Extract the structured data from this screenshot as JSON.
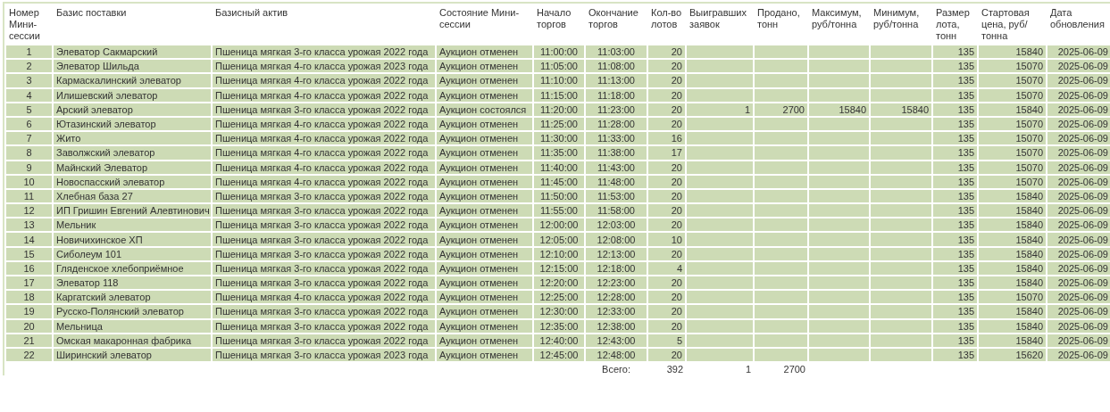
{
  "table": {
    "columns": [
      "Номер Мини-сессии",
      "Базис поставки",
      "Базисный актив",
      "Состояние Мини-сессии",
      "Начало торгов",
      "Окончание торгов",
      "Кол-во лотов",
      "Выигравших заявок",
      "Продано, тонн",
      "Максимум, руб/тонна",
      "Минимум, руб/тонна",
      "Размер лота, тонн",
      "Стартовая цена, руб/тонна",
      "Дата обновления"
    ],
    "rows": [
      {
        "num": "1",
        "basis": "Элеватор Сакмарский",
        "asset": "Пшеница мягкая 3-го класса урожая 2022 года",
        "state": "Аукцион отменен",
        "start": "11:00:00",
        "end": "11:03:00",
        "lots": "20",
        "lot_size": "135",
        "price": "15840",
        "date": "2025-06-09"
      },
      {
        "num": "2",
        "basis": "Элеватор Шильда",
        "asset": "Пшеница мягкая 4-го класса урожая 2023 года",
        "state": "Аукцион отменен",
        "start": "11:05:00",
        "end": "11:08:00",
        "lots": "20",
        "lot_size": "135",
        "price": "15070",
        "date": "2025-06-09"
      },
      {
        "num": "3",
        "basis": "Кармаскалинский элеватор",
        "asset": "Пшеница мягкая 4-го класса урожая 2022 года",
        "state": "Аукцион отменен",
        "start": "11:10:00",
        "end": "11:13:00",
        "lots": "20",
        "lot_size": "135",
        "price": "15070",
        "date": "2025-06-09"
      },
      {
        "num": "4",
        "basis": "Илишевский элеватор",
        "asset": "Пшеница мягкая 4-го класса урожая 2022 года",
        "state": "Аукцион отменен",
        "start": "11:15:00",
        "end": "11:18:00",
        "lots": "20",
        "lot_size": "135",
        "price": "15070",
        "date": "2025-06-09"
      },
      {
        "num": "5",
        "basis": "Арский элеватор",
        "asset": "Пшеница мягкая 3-го класса урожая 2022 года",
        "state": "Аукцион состоялся",
        "start": "11:20:00",
        "end": "11:23:00",
        "lots": "20",
        "won": "1",
        "sold": "2700",
        "max": "15840",
        "min": "15840",
        "lot_size": "135",
        "price": "15840",
        "date": "2025-06-09"
      },
      {
        "num": "6",
        "basis": "Ютазинский элеватор",
        "asset": "Пшеница мягкая 4-го класса урожая 2022 года",
        "state": "Аукцион отменен",
        "start": "11:25:00",
        "end": "11:28:00",
        "lots": "20",
        "lot_size": "135",
        "price": "15070",
        "date": "2025-06-09"
      },
      {
        "num": "7",
        "basis": "Жито",
        "asset": "Пшеница мягкая 4-го класса урожая 2022 года",
        "state": "Аукцион отменен",
        "start": "11:30:00",
        "end": "11:33:00",
        "lots": "16",
        "lot_size": "135",
        "price": "15070",
        "date": "2025-06-09"
      },
      {
        "num": "8",
        "basis": "Заволжский элеватор",
        "asset": "Пшеница мягкая 4-го класса урожая 2022 года",
        "state": "Аукцион отменен",
        "start": "11:35:00",
        "end": "11:38:00",
        "lots": "17",
        "lot_size": "135",
        "price": "15070",
        "date": "2025-06-09"
      },
      {
        "num": "9",
        "basis": "Майнский Элеватор",
        "asset": "Пшеница мягкая 4-го класса урожая 2022 года",
        "state": "Аукцион отменен",
        "start": "11:40:00",
        "end": "11:43:00",
        "lots": "20",
        "lot_size": "135",
        "price": "15070",
        "date": "2025-06-09"
      },
      {
        "num": "10",
        "basis": "Новоспасский элеватор",
        "asset": "Пшеница мягкая 4-го класса урожая 2022 года",
        "state": "Аукцион отменен",
        "start": "11:45:00",
        "end": "11:48:00",
        "lots": "20",
        "lot_size": "135",
        "price": "15070",
        "date": "2025-06-09"
      },
      {
        "num": "11",
        "basis": "Хлебная база 27",
        "asset": "Пшеница мягкая 3-го класса урожая 2022 года",
        "state": "Аукцион отменен",
        "start": "11:50:00",
        "end": "11:53:00",
        "lots": "20",
        "lot_size": "135",
        "price": "15840",
        "date": "2025-06-09"
      },
      {
        "num": "12",
        "basis": "ИП Гришин Евгений Алевтинович",
        "asset": "Пшеница мягкая 3-го класса урожая 2022 года",
        "state": "Аукцион отменен",
        "start": "11:55:00",
        "end": "11:58:00",
        "lots": "20",
        "lot_size": "135",
        "price": "15840",
        "date": "2025-06-09"
      },
      {
        "num": "13",
        "basis": "Мельник",
        "asset": "Пшеница мягкая 3-го класса урожая 2022 года",
        "state": "Аукцион отменен",
        "start": "12:00:00",
        "end": "12:03:00",
        "lots": "20",
        "lot_size": "135",
        "price": "15840",
        "date": "2025-06-09"
      },
      {
        "num": "14",
        "basis": "Новичихинское ХП",
        "asset": "Пшеница мягкая 3-го класса урожая 2022 года",
        "state": "Аукцион отменен",
        "start": "12:05:00",
        "end": "12:08:00",
        "lots": "10",
        "lot_size": "135",
        "price": "15840",
        "date": "2025-06-09"
      },
      {
        "num": "15",
        "basis": "Сиболеум 101",
        "asset": "Пшеница мягкая 3-го класса урожая 2022 года",
        "state": "Аукцион отменен",
        "start": "12:10:00",
        "end": "12:13:00",
        "lots": "20",
        "lot_size": "135",
        "price": "15840",
        "date": "2025-06-09"
      },
      {
        "num": "16",
        "basis": "Гляденское хлебоприёмное",
        "asset": "Пшеница мягкая 3-го класса урожая 2022 года",
        "state": "Аукцион отменен",
        "start": "12:15:00",
        "end": "12:18:00",
        "lots": "4",
        "lot_size": "135",
        "price": "15840",
        "date": "2025-06-09"
      },
      {
        "num": "17",
        "basis": "Элеватор 118",
        "asset": "Пшеница мягкая 3-го класса урожая 2022 года",
        "state": "Аукцион отменен",
        "start": "12:20:00",
        "end": "12:23:00",
        "lots": "20",
        "lot_size": "135",
        "price": "15840",
        "date": "2025-06-09"
      },
      {
        "num": "18",
        "basis": "Каргатский элеватор",
        "asset": "Пшеница мягкая 4-го класса урожая 2022 года",
        "state": "Аукцион отменен",
        "start": "12:25:00",
        "end": "12:28:00",
        "lots": "20",
        "lot_size": "135",
        "price": "15070",
        "date": "2025-06-09"
      },
      {
        "num": "19",
        "basis": "Русско-Полянский элеватор",
        "asset": "Пшеница мягкая 3-го класса урожая 2022 года",
        "state": "Аукцион отменен",
        "start": "12:30:00",
        "end": "12:33:00",
        "lots": "20",
        "lot_size": "135",
        "price": "15840",
        "date": "2025-06-09"
      },
      {
        "num": "20",
        "basis": "Мельница",
        "asset": "Пшеница мягкая 3-го класса урожая 2022 года",
        "state": "Аукцион отменен",
        "start": "12:35:00",
        "end": "12:38:00",
        "lots": "20",
        "lot_size": "135",
        "price": "15840",
        "date": "2025-06-09"
      },
      {
        "num": "21",
        "basis": "Омская макаронная фабрика",
        "asset": "Пшеница мягкая 3-го класса урожая 2022 года",
        "state": "Аукцион отменен",
        "start": "12:40:00",
        "end": "12:43:00",
        "lots": "5",
        "lot_size": "135",
        "price": "15840",
        "date": "2025-06-09"
      },
      {
        "num": "22",
        "basis": "Ширинский элеватор",
        "asset": "Пшеница мягкая 3-го класса урожая 2023 года",
        "state": "Аукцион отменен",
        "start": "12:45:00",
        "end": "12:48:00",
        "lots": "20",
        "lot_size": "135",
        "price": "15620",
        "date": "2025-06-09"
      }
    ],
    "totals": {
      "end": "Всего:",
      "lots": "392",
      "won": "1",
      "sold": "2700"
    }
  }
}
